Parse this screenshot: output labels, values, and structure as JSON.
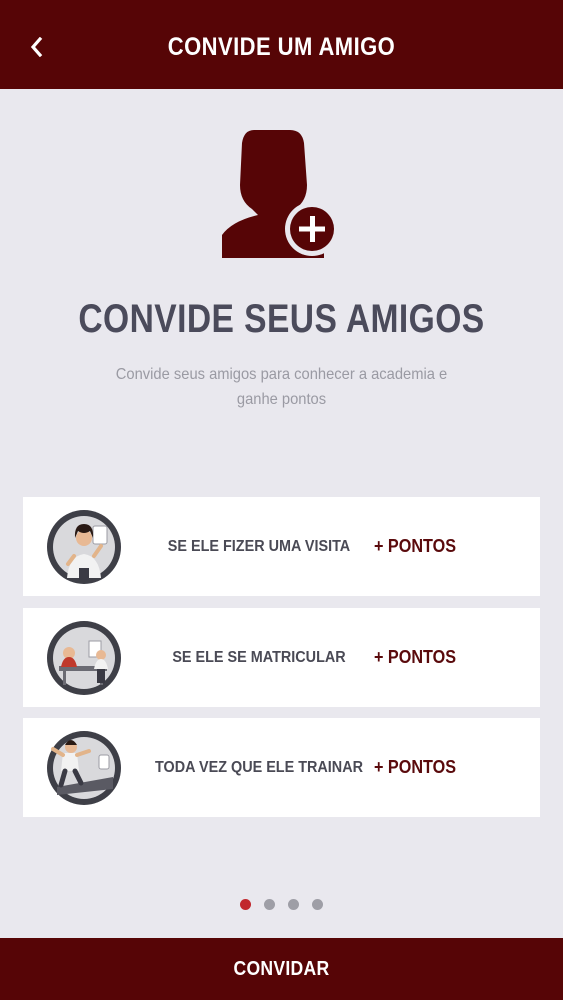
{
  "header": {
    "title": "CONVIDE UM AMIGO",
    "back_icon": "chevron-left-icon"
  },
  "hero": {
    "icon": "add-user-icon",
    "title": "CONVIDE SEUS AMIGOS",
    "subtitle": "Convide seus amigos para conhecer a academia e ganhe pontos"
  },
  "rewards": [
    {
      "label": "SE ELE FIZER UMA VISITA",
      "points": "+ PONTOS",
      "icon": "visit-illustration-icon"
    },
    {
      "label": "SE ELE SE MATRICULAR",
      "points": "+ PONTOS",
      "icon": "enroll-illustration-icon"
    },
    {
      "label": "TODA VEZ QUE ELE TRAINAR",
      "points": "+ PONTOS",
      "icon": "train-illustration-icon"
    }
  ],
  "pagination": {
    "total": 4,
    "active": 1
  },
  "footer": {
    "button_label": "CONVIDAR"
  },
  "colors": {
    "brand": "#560506",
    "accent_dot": "#c1272d",
    "background": "#e9e8ee"
  }
}
